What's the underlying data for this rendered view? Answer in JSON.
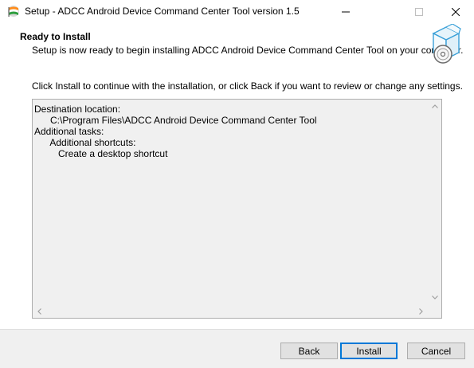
{
  "window": {
    "title": "Setup - ADCC Android Device Command Center Tool version 1.5"
  },
  "header": {
    "title": "Ready to Install",
    "subtitle": "Setup is now ready to begin installing ADCC Android Device Command Center Tool on your computer."
  },
  "instructions": "Click Install to continue with the installation, or click Back if you want to review or change any settings.",
  "memo": {
    "lines": [
      "Destination location:",
      "      C:\\Program Files\\ADCC Android Device Command Center Tool",
      "",
      "Additional tasks:",
      "      Additional shortcuts:",
      "         Create a desktop shortcut"
    ]
  },
  "buttons": {
    "back": "Back",
    "install": "Install",
    "cancel": "Cancel"
  },
  "icons": {
    "app": "installer-flag-icon",
    "header": "box-with-disc-icon"
  },
  "colors": {
    "accent": "#0078d7",
    "footer_bg": "#f0f0f0",
    "memo_bg": "#f0f0f0"
  }
}
